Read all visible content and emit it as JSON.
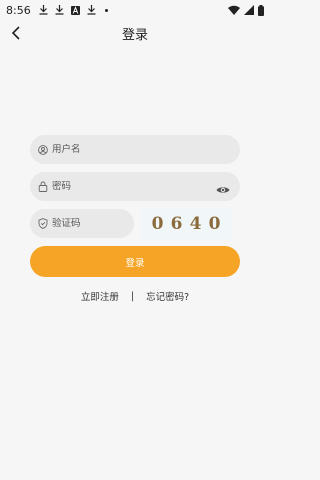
{
  "status_bar": {
    "time": "8:56",
    "icons_left": [
      "download-icon",
      "download-icon",
      "font-a-icon",
      "download-icon",
      "dot-icon"
    ],
    "icons_right": [
      "wifi-icon",
      "signal-icon",
      "battery-icon"
    ]
  },
  "header": {
    "title": "登录",
    "back_icon": "chevron-left-icon"
  },
  "form": {
    "username_placeholder": "用户名",
    "password_placeholder": "密码",
    "captcha_placeholder": "验证码",
    "captcha_code": [
      "0",
      "6",
      "4",
      "0"
    ],
    "login_label": "登录"
  },
  "links": {
    "register": "立即注册",
    "separator": "|",
    "forgot": "忘记密码?"
  },
  "colors": {
    "accent": "#f6a425",
    "background": "#f6f6f6",
    "field_bg": "#e9e9e9",
    "captcha_text": "#8b6b3e"
  }
}
